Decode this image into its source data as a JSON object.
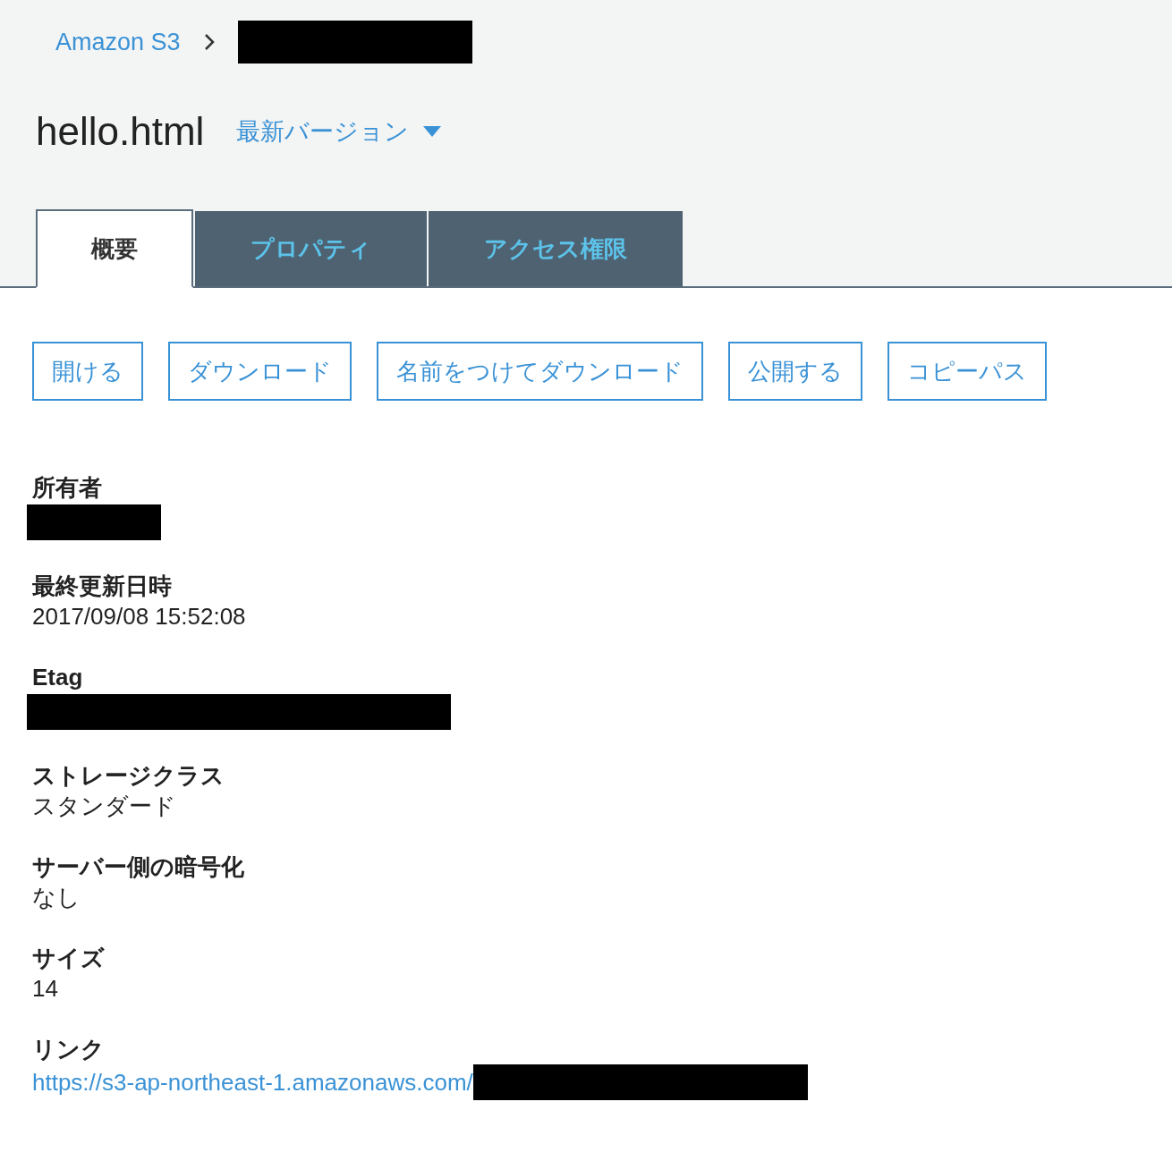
{
  "breadcrumb": {
    "root": "Amazon S3"
  },
  "title": "hello.html",
  "version_menu": {
    "label": "最新バージョン"
  },
  "tabs": [
    {
      "label": "概要",
      "selected": true
    },
    {
      "label": "プロパティ",
      "selected": false
    },
    {
      "label": "アクセス権限",
      "selected": false
    }
  ],
  "actions": [
    "開ける",
    "ダウンロード",
    "名前をつけてダウンロード",
    "公開する",
    "コピーパス"
  ],
  "fields": [
    {
      "label": "所有者",
      "kind": "redacted"
    },
    {
      "label": "最終更新日時",
      "kind": "text",
      "value": "2017/09/08 15:52:08"
    },
    {
      "label": "Etag",
      "kind": "redacted"
    },
    {
      "label": "ストレージクラス",
      "kind": "text",
      "value": "スタンダード"
    },
    {
      "label": "サーバー側の暗号化",
      "kind": "text",
      "value": "なし"
    },
    {
      "label": "サイズ",
      "kind": "text",
      "value": "14"
    },
    {
      "label": "リンク",
      "kind": "link",
      "value": "https://s3-ap-northeast-1.amazonaws.com/"
    }
  ]
}
